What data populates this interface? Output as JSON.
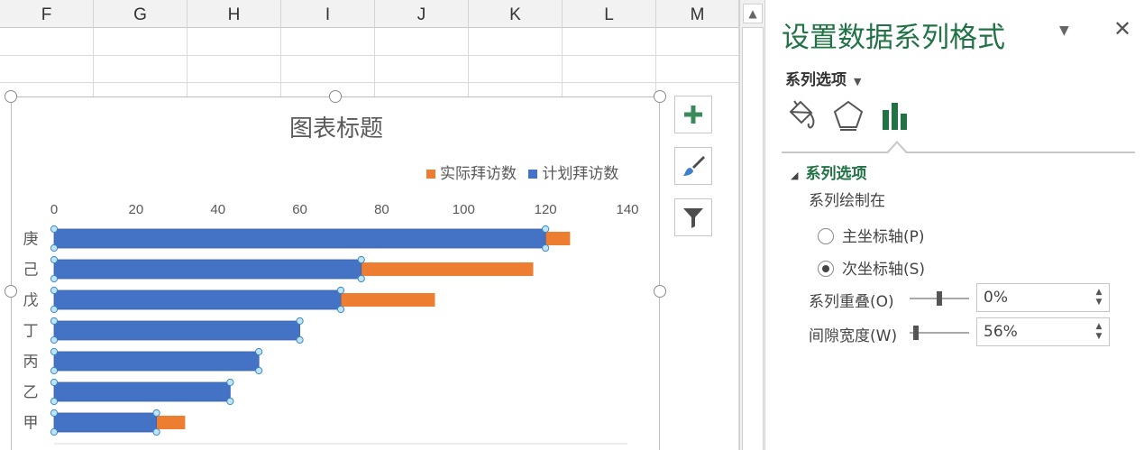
{
  "sheet": {
    "columns": [
      "F",
      "G",
      "H",
      "I",
      "J",
      "K",
      "L",
      "M"
    ]
  },
  "chart": {
    "title": "图表标题",
    "legend": [
      {
        "name": "实际拜访数",
        "color": "#ED7D31"
      },
      {
        "name": "计划拜访数",
        "color": "#4472C4"
      }
    ]
  },
  "chart_data": {
    "type": "bar",
    "orientation": "horizontal",
    "title": "图表标题",
    "categories": [
      "庚",
      "己",
      "戊",
      "丁",
      "丙",
      "乙",
      "甲"
    ],
    "series": [
      {
        "name": "实际拜访数",
        "color": "#ED7D31",
        "values": [
          126,
          117,
          93,
          60,
          50,
          43,
          32
        ]
      },
      {
        "name": "计划拜访数",
        "color": "#4472C4",
        "values": [
          120,
          75,
          70,
          60,
          50,
          43,
          25
        ]
      }
    ],
    "xlim": [
      0,
      140
    ],
    "xticks": [
      0,
      20,
      40,
      60,
      80,
      100,
      120,
      140
    ],
    "axis_position": "top",
    "legend_position": "top-right",
    "grid": false
  },
  "chart_buttons": [
    {
      "name": "add-chart-element-button",
      "icon": "plus-icon"
    },
    {
      "name": "chart-styles-button",
      "icon": "brush-icon"
    },
    {
      "name": "chart-filters-button",
      "icon": "filter-icon"
    }
  ],
  "pane": {
    "title": "设置数据系列格式",
    "menu_label": "系列选项",
    "section_title": "系列选项",
    "plot_on_label": "系列绘制在",
    "primary_axis": "主坐标轴(P)",
    "primary_axis_key": "P",
    "secondary_axis": "次坐标轴(S)",
    "secondary_axis_key": "S",
    "selected_axis": "secondary",
    "overlap_label": "系列重叠(O)",
    "overlap_value": "0%",
    "overlap_fraction": 0.5,
    "gap_label": "间隙宽度(W)",
    "gap_value": "56%",
    "gap_fraction": 0.112,
    "accent_color": "#217346"
  }
}
